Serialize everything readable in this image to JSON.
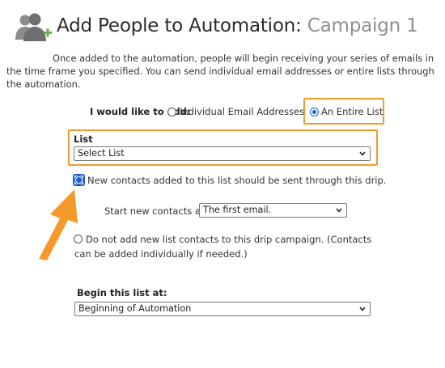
{
  "header": {
    "title": "Add People to Automation:",
    "campaign": "Campaign 1"
  },
  "intro_text": "Once added to the automation, people will begin receiving your series of emails in the time frame you specified. You can send individual email addresses or entire lists through the automation.",
  "add_section": {
    "label": "I would like to add:",
    "option_individual": "Individual Email Addresses",
    "option_list": "An Entire List",
    "selected": "An Entire List"
  },
  "list_section": {
    "label": "List",
    "select_value": "Select List"
  },
  "drip_options": {
    "send_new": "New contacts added to this list should be sent through this drip.",
    "start_label": "Start new contacts at:",
    "start_value": "The first email.",
    "do_not_add": "Do not add new list contacts to this drip campaign. (Contacts can be added individually if needed.)",
    "selected": "send_new"
  },
  "begin_section": {
    "label": "Begin this list at:",
    "select_value": "Beginning of Automation"
  },
  "colors": {
    "highlight": "#f39a2c",
    "radio_accent": "#1f5fc9",
    "arrow": "#f5992a"
  }
}
